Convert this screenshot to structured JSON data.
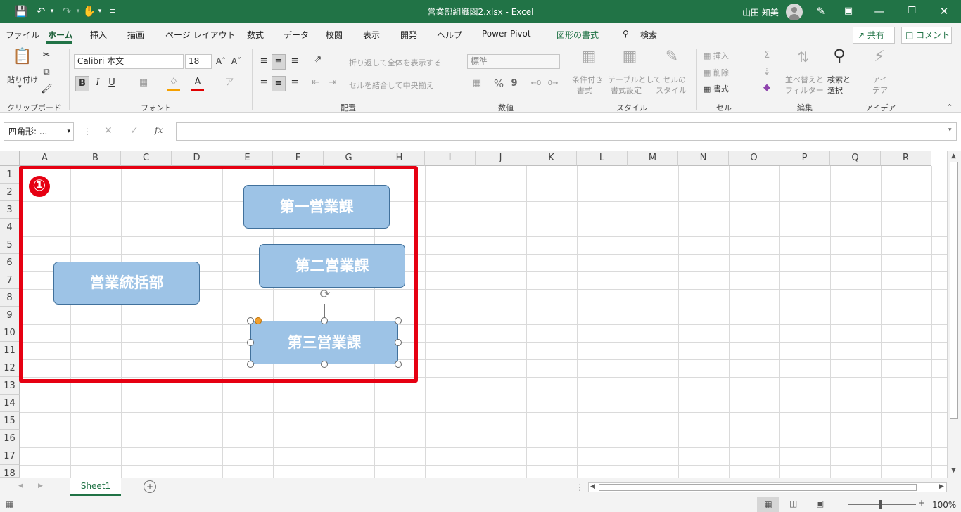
{
  "title_bar": {
    "title": "営業部組織図2.xlsx  -  Excel",
    "user_name": "山田 知美"
  },
  "tabs": [
    "ファイル",
    "ホーム",
    "挿入",
    "描画",
    "ページ レイアウト",
    "数式",
    "データ",
    "校閲",
    "表示",
    "開発",
    "ヘルプ",
    "Power Pivot",
    "図形の書式",
    "検索"
  ],
  "share_label": "共有",
  "comment_label": "コメント",
  "ribbon": {
    "clipboard": {
      "paste": "貼り付け",
      "group": "クリップボード"
    },
    "font": {
      "name": "Calibri 本文",
      "size": "18",
      "bold": "B",
      "italic": "I",
      "underline": "U",
      "group": "フォント"
    },
    "alignment": {
      "wrap_text": "折り返して全体を表示する",
      "merge_center": "セルを結合して中央揃え",
      "group": "配置"
    },
    "number": {
      "format": "標準",
      "percent": "%",
      "comma": "9",
      "group": "数値"
    },
    "styles": {
      "conditional": [
        "条件付き",
        "書式"
      ],
      "table": [
        "テーブルとして",
        "書式設定"
      ],
      "cell": [
        "セルの",
        "スタイル"
      ],
      "group": "スタイル"
    },
    "cells": {
      "insert": "挿入",
      "delete": "削除",
      "format": "書式",
      "group": "セル"
    },
    "editing": {
      "sort": [
        "並べ替えと",
        "フィルター"
      ],
      "find": [
        "検索と",
        "選択"
      ],
      "group": "編集"
    },
    "ideas": {
      "label": [
        "アイ",
        "デア"
      ],
      "group": "アイデア"
    }
  },
  "formula_bar": {
    "name_box": "四角形: ...",
    "fx": "fx",
    "value": ""
  },
  "columns": [
    "A",
    "B",
    "C",
    "D",
    "E",
    "F",
    "G",
    "H",
    "I",
    "J",
    "K",
    "L",
    "M",
    "N",
    "O",
    "P",
    "Q",
    "R"
  ],
  "rows": [
    "1",
    "2",
    "3",
    "4",
    "5",
    "6",
    "7",
    "8",
    "9",
    "10",
    "11",
    "12",
    "13",
    "14",
    "15",
    "16",
    "17",
    "18"
  ],
  "annotation": "①",
  "shapes": {
    "head": "営業統括部",
    "sec1": "第一営業課",
    "sec2": "第二営業課",
    "sec3": "第三営業課"
  },
  "sheet_tab": "Sheet1",
  "zoom": "100%",
  "colors": {
    "excel_green": "#217346",
    "shape_fill": "#9dc3e6",
    "shape_border": "#41719c",
    "annotation_red": "#e60012"
  }
}
